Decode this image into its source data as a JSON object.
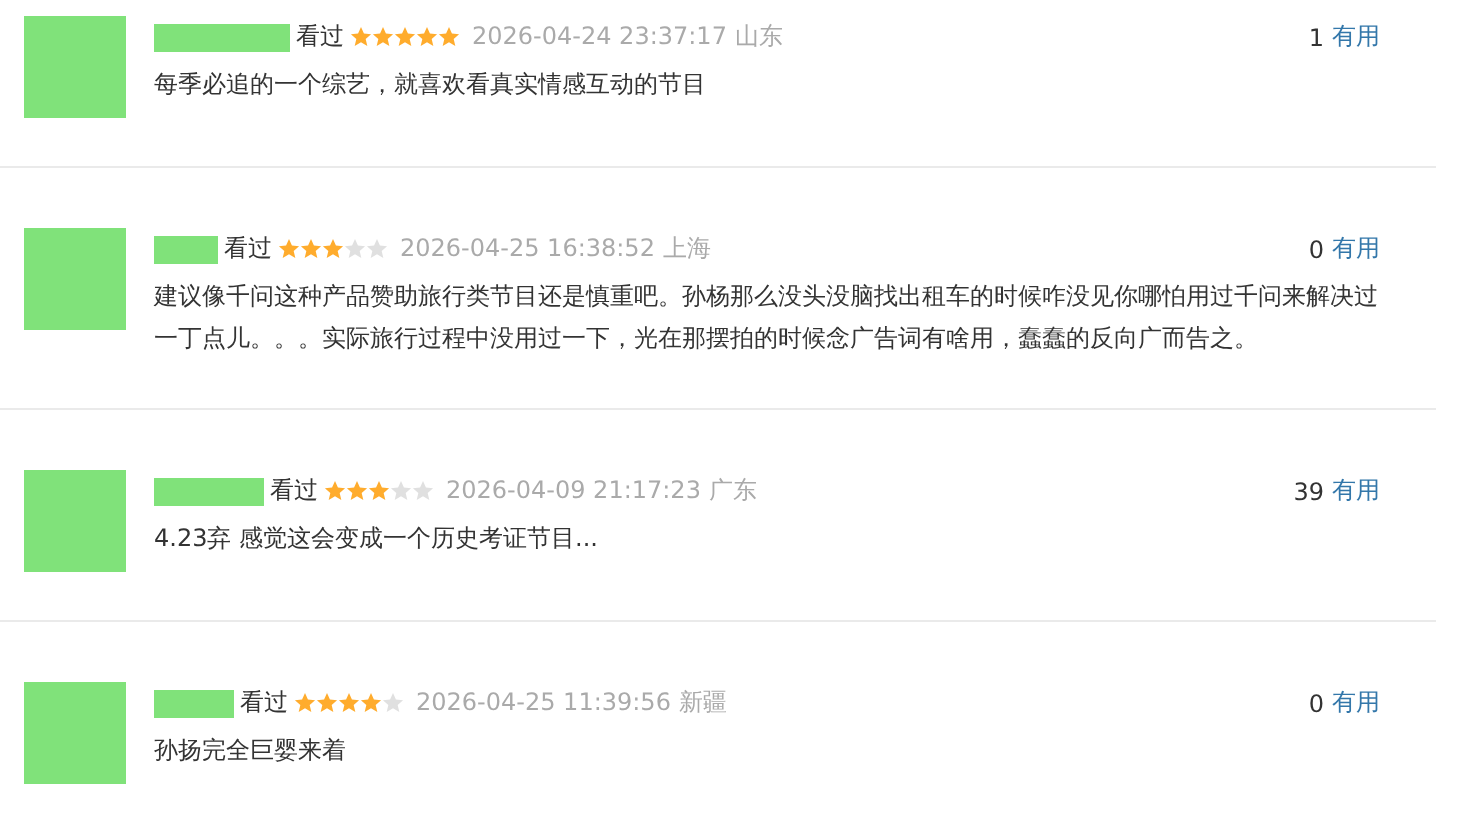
{
  "comments": [
    {
      "status": "看过",
      "stars": 5,
      "time": "2026-04-24 23:37:17",
      "location": "山东",
      "votes": "1",
      "votes_label": "有用",
      "text": "每季必追的一个综艺，就喜欢看真实情感互动的节目"
    },
    {
      "status": "看过",
      "stars": 3,
      "time": "2026-04-25 16:38:52",
      "location": "上海",
      "votes": "0",
      "votes_label": "有用",
      "text": "建议像千问这种产品赞助旅行类节目还是慎重吧。孙杨那么没头没脑找出租车的时候咋没见你哪怕用过千问来解决过一丁点儿。。。实际旅行过程中没用过一下，光在那摆拍的时候念广告词有啥用，蠢蠢的反向广而告之。"
    },
    {
      "status": "看过",
      "stars": 3,
      "time": "2026-04-09 21:17:23",
      "location": "广东",
      "votes": "39",
      "votes_label": "有用",
      "text": "4.23弃 感觉这会变成一个历史考证节目..."
    },
    {
      "status": "看过",
      "stars": 4,
      "time": "2026-04-25 11:39:56",
      "location": "新疆",
      "votes": "0",
      "votes_label": "有用",
      "text": "孙扬完全巨婴来着"
    }
  ]
}
